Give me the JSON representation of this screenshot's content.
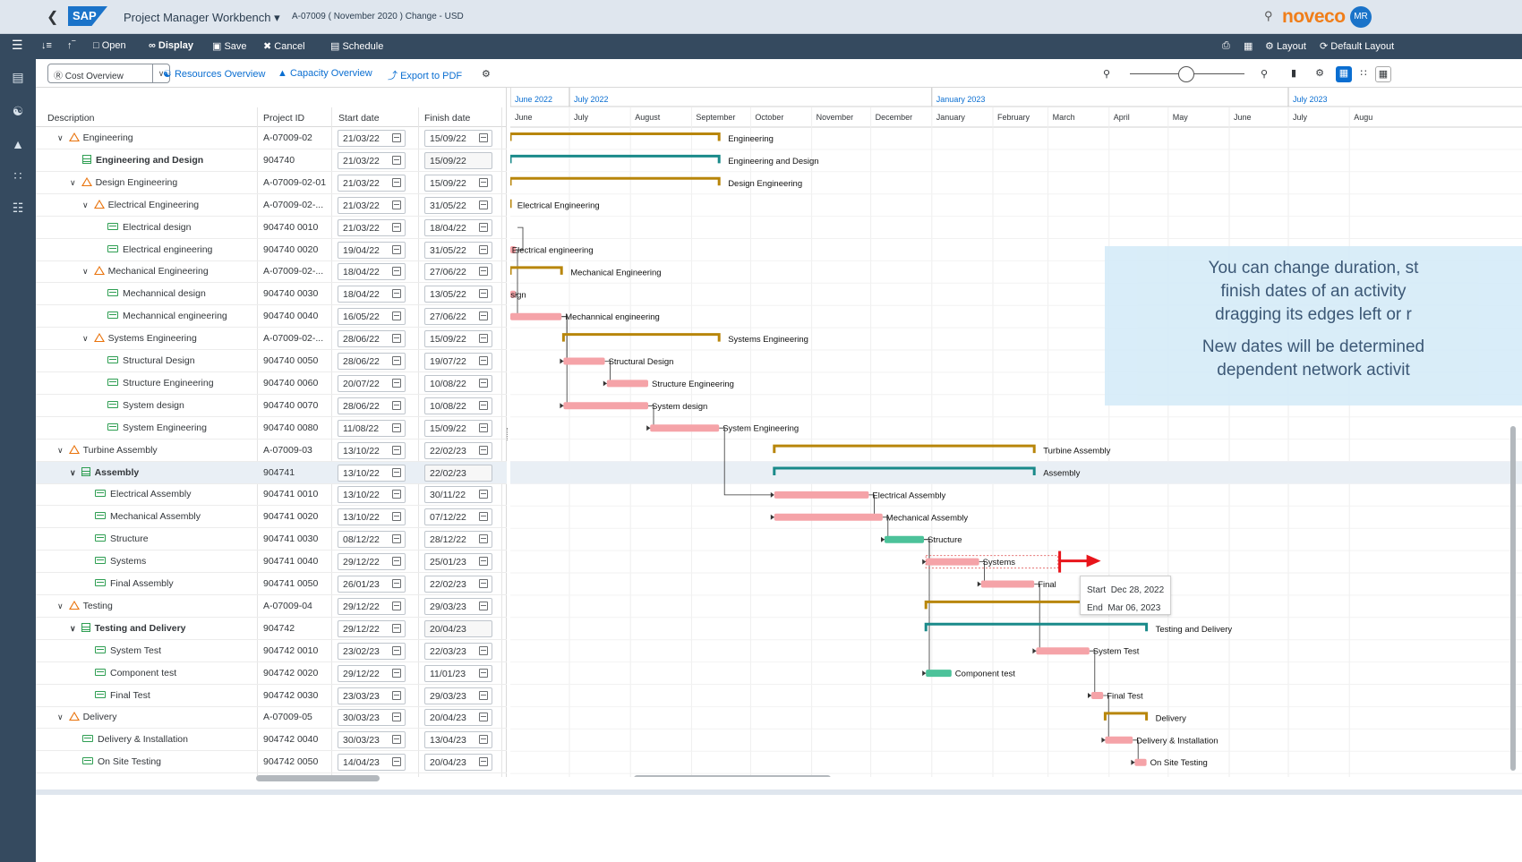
{
  "shell": {
    "app_title": "Project Manager Workbench",
    "subtitle": "A-07009 ( November 2020 ) Change - USD",
    "brand": "noveco",
    "avatar": "MR",
    "colors": {
      "brand_orange": "#f07e1a",
      "sap_blue": "#1a73c9",
      "nav_dark": "#354a5f"
    }
  },
  "toolbar": {
    "open": "Open",
    "display": "Display",
    "save": "Save",
    "cancel": "Cancel",
    "schedule": "Schedule",
    "layout": "Layout",
    "default_layout": "Default Layout"
  },
  "subtoolbar": {
    "cost_overview": "Cost Overview",
    "resources_overview": "Resources Overview",
    "capacity_overview": "Capacity Overview",
    "export_pdf": "Export to PDF"
  },
  "table": {
    "columns": [
      "Description",
      "Project ID",
      "Start date",
      "Finish date"
    ],
    "rows": [
      {
        "level": 1,
        "icon": "warning",
        "expand": true,
        "bold": false,
        "desc": "Engineering",
        "id": "A-07009-02",
        "start": "21/03/22",
        "finish": "15/09/22",
        "ro": false
      },
      {
        "level": 2,
        "icon": "grid",
        "expand": false,
        "bold": true,
        "desc": "Engineering and Design",
        "id": "904740",
        "start": "21/03/22",
        "finish": "15/09/22",
        "ro": true
      },
      {
        "level": 2,
        "icon": "warning",
        "expand": true,
        "bold": false,
        "desc": "Design Engineering",
        "id": "A-07009-02-01",
        "start": "21/03/22",
        "finish": "15/09/22",
        "ro": false
      },
      {
        "level": 3,
        "icon": "warning",
        "expand": true,
        "bold": false,
        "desc": "Electrical Engineering",
        "id": "A-07009-02-...",
        "start": "21/03/22",
        "finish": "31/05/22",
        "ro": false
      },
      {
        "level": 4,
        "icon": "task",
        "expand": false,
        "bold": false,
        "desc": "Electrical design",
        "id": "904740 0010",
        "start": "21/03/22",
        "finish": "18/04/22",
        "ro": false
      },
      {
        "level": 4,
        "icon": "task",
        "expand": false,
        "bold": false,
        "desc": "Electrical engineering",
        "id": "904740 0020",
        "start": "19/04/22",
        "finish": "31/05/22",
        "ro": false
      },
      {
        "level": 3,
        "icon": "warning",
        "expand": true,
        "bold": false,
        "desc": "Mechanical Engineering",
        "id": "A-07009-02-...",
        "start": "18/04/22",
        "finish": "27/06/22",
        "ro": false
      },
      {
        "level": 4,
        "icon": "task",
        "expand": false,
        "bold": false,
        "desc": "Mechannical design",
        "id": "904740 0030",
        "start": "18/04/22",
        "finish": "13/05/22",
        "ro": false
      },
      {
        "level": 4,
        "icon": "task",
        "expand": false,
        "bold": false,
        "desc": "Mechannical engineering",
        "id": "904740 0040",
        "start": "16/05/22",
        "finish": "27/06/22",
        "ro": false
      },
      {
        "level": 3,
        "icon": "warning",
        "expand": true,
        "bold": false,
        "desc": "Systems Engineering",
        "id": "A-07009-02-...",
        "start": "28/06/22",
        "finish": "15/09/22",
        "ro": false
      },
      {
        "level": 4,
        "icon": "task",
        "expand": false,
        "bold": false,
        "desc": "Structural Design",
        "id": "904740 0050",
        "start": "28/06/22",
        "finish": "19/07/22",
        "ro": false
      },
      {
        "level": 4,
        "icon": "task",
        "expand": false,
        "bold": false,
        "desc": "Structure Engineering",
        "id": "904740 0060",
        "start": "20/07/22",
        "finish": "10/08/22",
        "ro": false
      },
      {
        "level": 4,
        "icon": "task",
        "expand": false,
        "bold": false,
        "desc": "System design",
        "id": "904740 0070",
        "start": "28/06/22",
        "finish": "10/08/22",
        "ro": false
      },
      {
        "level": 4,
        "icon": "task",
        "expand": false,
        "bold": false,
        "desc": "System Engineering",
        "id": "904740 0080",
        "start": "11/08/22",
        "finish": "15/09/22",
        "ro": false
      },
      {
        "level": 1,
        "icon": "warning",
        "expand": true,
        "bold": false,
        "desc": "Turbine Assembly",
        "id": "A-07009-03",
        "start": "13/10/22",
        "finish": "22/02/23",
        "ro": false
      },
      {
        "level": 2,
        "icon": "grid",
        "expand": true,
        "bold": true,
        "desc": "Assembly",
        "id": "904741",
        "start": "13/10/22",
        "finish": "22/02/23",
        "ro": true,
        "selected": true
      },
      {
        "level": 3,
        "icon": "task",
        "expand": false,
        "bold": false,
        "desc": "Electrical Assembly",
        "id": "904741 0010",
        "start": "13/10/22",
        "finish": "30/11/22",
        "ro": false
      },
      {
        "level": 3,
        "icon": "task",
        "expand": false,
        "bold": false,
        "desc": "Mechanical Assembly",
        "id": "904741 0020",
        "start": "13/10/22",
        "finish": "07/12/22",
        "ro": false
      },
      {
        "level": 3,
        "icon": "task",
        "expand": false,
        "bold": false,
        "desc": "Structure",
        "id": "904741 0030",
        "start": "08/12/22",
        "finish": "28/12/22",
        "ro": false
      },
      {
        "level": 3,
        "icon": "task",
        "expand": false,
        "bold": false,
        "desc": "Systems",
        "id": "904741 0040",
        "start": "29/12/22",
        "finish": "25/01/23",
        "ro": false
      },
      {
        "level": 3,
        "icon": "task",
        "expand": false,
        "bold": false,
        "desc": "Final Assembly",
        "id": "904741 0050",
        "start": "26/01/23",
        "finish": "22/02/23",
        "ro": false
      },
      {
        "level": 1,
        "icon": "warning",
        "expand": true,
        "bold": false,
        "desc": "Testing",
        "id": "A-07009-04",
        "start": "29/12/22",
        "finish": "29/03/23",
        "ro": false
      },
      {
        "level": 2,
        "icon": "grid",
        "expand": true,
        "bold": true,
        "desc": "Testing and Delivery",
        "id": "904742",
        "start": "29/12/22",
        "finish": "20/04/23",
        "ro": true
      },
      {
        "level": 3,
        "icon": "task",
        "expand": false,
        "bold": false,
        "desc": "System Test",
        "id": "904742 0010",
        "start": "23/02/23",
        "finish": "22/03/23",
        "ro": false
      },
      {
        "level": 3,
        "icon": "task",
        "expand": false,
        "bold": false,
        "desc": "Component test",
        "id": "904742 0020",
        "start": "29/12/22",
        "finish": "11/01/23",
        "ro": false
      },
      {
        "level": 3,
        "icon": "task",
        "expand": false,
        "bold": false,
        "desc": "Final Test",
        "id": "904742 0030",
        "start": "23/03/23",
        "finish": "29/03/23",
        "ro": false
      },
      {
        "level": 1,
        "icon": "warning",
        "expand": true,
        "bold": false,
        "desc": "Delivery",
        "id": "A-07009-05",
        "start": "30/03/23",
        "finish": "20/04/23",
        "ro": false
      },
      {
        "level": 2,
        "icon": "task",
        "expand": false,
        "bold": false,
        "desc": "Delivery & Installation",
        "id": "904742 0040",
        "start": "30/03/23",
        "finish": "13/04/23",
        "ro": false
      },
      {
        "level": 2,
        "icon": "task",
        "expand": false,
        "bold": false,
        "desc": "On Site Testing",
        "id": "904742 0050",
        "start": "14/04/23",
        "finish": "20/04/23",
        "ro": false
      }
    ]
  },
  "gantt": {
    "years": [
      {
        "label": "June 2022",
        "month_index": 0
      },
      {
        "label": "July 2022",
        "month_index": 1
      },
      {
        "label": "January 2023",
        "month_index": 7
      },
      {
        "label": "July 2023",
        "month_index": 13
      }
    ],
    "months": [
      "June",
      "July",
      "August",
      "September",
      "October",
      "November",
      "December",
      "January",
      "February",
      "March",
      "April",
      "May",
      "June",
      "July",
      "Augu"
    ],
    "bars": [
      {
        "row": 0,
        "type": "summary",
        "start": "2022-03-21",
        "end": "2022-09-15",
        "label": "Engineering"
      },
      {
        "row": 1,
        "type": "project",
        "start": "2022-03-21",
        "end": "2022-09-15",
        "label": "Engineering and Design"
      },
      {
        "row": 2,
        "type": "summary",
        "start": "2022-03-21",
        "end": "2022-09-15",
        "label": "Design Engineering"
      },
      {
        "row": 3,
        "type": "summary",
        "start": "2022-03-21",
        "end": "2022-05-31",
        "label": "Electrical Engineering"
      },
      {
        "row": 5,
        "type": "task",
        "start": "2022-04-19",
        "end": "2022-05-31",
        "label": "Electrical engineering"
      },
      {
        "row": 6,
        "type": "summary",
        "start": "2022-04-18",
        "end": "2022-06-27",
        "label": "Mechanical Engineering"
      },
      {
        "row": 7,
        "type": "task",
        "start": "2022-04-18",
        "end": "2022-05-13",
        "label": "nnical design"
      },
      {
        "row": 8,
        "type": "task",
        "start": "2022-05-16",
        "end": "2022-06-27",
        "label": "Mechannical engineering"
      },
      {
        "row": 9,
        "type": "summary",
        "start": "2022-06-28",
        "end": "2022-09-15",
        "label": "Systems Engineering"
      },
      {
        "row": 10,
        "type": "task",
        "start": "2022-06-28",
        "end": "2022-07-19",
        "label": "Structural Design"
      },
      {
        "row": 11,
        "type": "task",
        "start": "2022-07-20",
        "end": "2022-08-10",
        "label": "Structure Engineering"
      },
      {
        "row": 12,
        "type": "task",
        "start": "2022-06-28",
        "end": "2022-08-10",
        "label": "System design"
      },
      {
        "row": 13,
        "type": "task",
        "start": "2022-08-11",
        "end": "2022-09-15",
        "label": "System Engineering"
      },
      {
        "row": 14,
        "type": "summary",
        "start": "2022-10-13",
        "end": "2023-02-22",
        "label": "Turbine Assembly"
      },
      {
        "row": 15,
        "type": "project",
        "start": "2022-10-13",
        "end": "2023-02-22",
        "label": "Assembly"
      },
      {
        "row": 16,
        "type": "task",
        "start": "2022-10-13",
        "end": "2022-11-30",
        "label": "Electrical Assembly"
      },
      {
        "row": 17,
        "type": "task",
        "start": "2022-10-13",
        "end": "2022-12-07",
        "label": "Mechanical Assembly"
      },
      {
        "row": 18,
        "type": "done",
        "start": "2022-12-08",
        "end": "2022-12-28",
        "label": "Structure"
      },
      {
        "row": 19,
        "type": "task",
        "start": "2022-12-29",
        "end": "2023-01-25",
        "label": "Systems"
      },
      {
        "row": 20,
        "type": "task",
        "start": "2023-01-26",
        "end": "2023-02-22",
        "label": "Final"
      },
      {
        "row": 21,
        "type": "summary",
        "start": "2022-12-29",
        "end": "2023-03-29",
        "label": ""
      },
      {
        "row": 22,
        "type": "project",
        "start": "2022-12-29",
        "end": "2023-04-20",
        "label": "Testing and Delivery"
      },
      {
        "row": 23,
        "type": "task",
        "start": "2023-02-23",
        "end": "2023-03-22",
        "label": "System Test"
      },
      {
        "row": 24,
        "type": "done",
        "start": "2022-12-29",
        "end": "2023-01-11",
        "label": "Component test"
      },
      {
        "row": 25,
        "type": "task",
        "start": "2023-03-23",
        "end": "2023-03-29",
        "label": "Final Test"
      },
      {
        "row": 26,
        "type": "summary",
        "start": "2023-03-30",
        "end": "2023-04-20",
        "label": "Delivery"
      },
      {
        "row": 27,
        "type": "task",
        "start": "2023-03-30",
        "end": "2023-04-13",
        "label": "Delivery & Installation"
      },
      {
        "row": 28,
        "type": "task",
        "start": "2023-04-14",
        "end": "2023-04-20",
        "label": "On Site Testing"
      }
    ],
    "drag_preview": {
      "row": 19,
      "start": "2022-12-29",
      "end": "2023-03-06"
    },
    "colors": {
      "summary": "#b8860b",
      "project": "#1a8a8a",
      "task": "#f5a3a8",
      "done": "#4cc29a",
      "arrow": "#e8151b"
    }
  },
  "date_tooltip": {
    "start_label": "Start",
    "start_value": "Dec 28, 2022",
    "end_label": "End",
    "end_value": "Mar 06, 2023"
  },
  "hint": {
    "lines1": [
      "You can change duration, st",
      "finish dates of an activity",
      "dragging its edges left or r"
    ],
    "lines2": [
      "New dates will be determined",
      "dependent network activit"
    ]
  }
}
